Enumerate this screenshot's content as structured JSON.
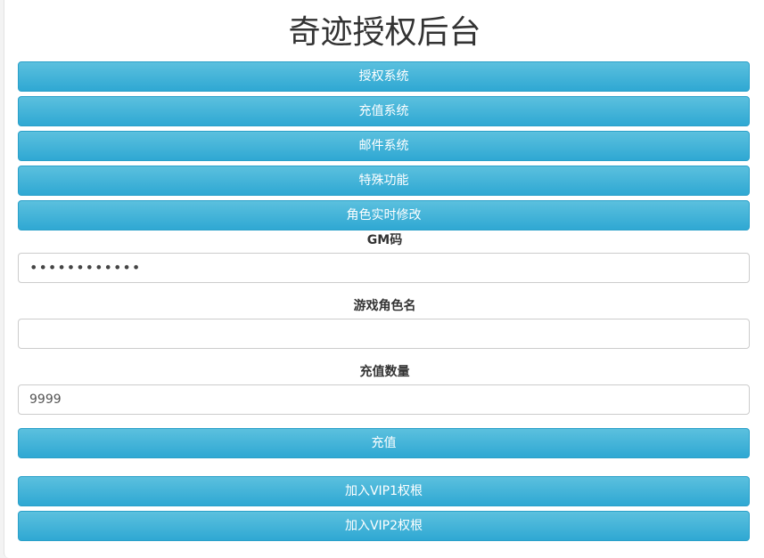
{
  "page": {
    "title": "奇迹授权后台"
  },
  "menu": {
    "items": [
      "授权系统",
      "充值系统",
      "邮件系统",
      "特殊功能",
      "角色实时修改"
    ]
  },
  "form": {
    "gm_code": {
      "label": "GM码",
      "value": "••••••••••••"
    },
    "role_name": {
      "label": "游戏角色名",
      "value": ""
    },
    "amount": {
      "label": "充值数量",
      "value": "9999"
    },
    "submit_label": "充值",
    "vip1_label": "加入VIP1权根",
    "vip2_label": "加入VIP2权根"
  },
  "colors": {
    "button": "#31b0d5",
    "button_border": "#2aa0c9",
    "title_text": "#333333"
  }
}
